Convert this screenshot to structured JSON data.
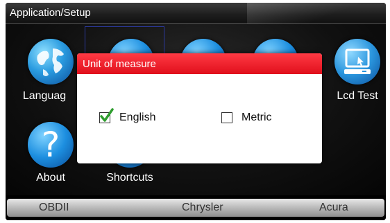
{
  "header": {
    "title": "Application/Setup"
  },
  "apps": [
    {
      "label": "Languag",
      "icon": "globe-icon"
    },
    {
      "label": "Lcd Test",
      "icon": "monitor-icon"
    },
    {
      "label": "About",
      "icon": "question-icon"
    },
    {
      "label": "Shortcuts",
      "icon": "shortcuts-icon"
    }
  ],
  "dialog": {
    "title": "Unit of measure",
    "options": [
      {
        "label": "English",
        "checked": true
      },
      {
        "label": "Metric",
        "checked": false
      }
    ]
  },
  "bottom_tabs": [
    "OBDII",
    "Chrysler",
    "Acura"
  ],
  "colors": {
    "dialog_header": "#e8101e",
    "check_green": "#2e9d2e"
  }
}
